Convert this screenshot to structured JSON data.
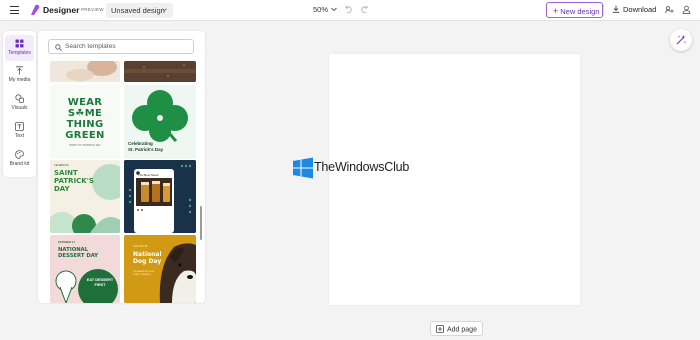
{
  "header": {
    "app_name": "Designer",
    "preview_badge": "PREVIEW",
    "design_name": "Unsaved design",
    "zoom_level": "50%",
    "new_design_label": "New design",
    "download_label": "Download"
  },
  "rail": {
    "items": [
      {
        "label": "Templates",
        "icon": "templates-icon",
        "active": true
      },
      {
        "label": "My media",
        "icon": "upload-icon",
        "active": false
      },
      {
        "label": "Visuals",
        "icon": "shapes-icon",
        "active": false
      },
      {
        "label": "Text",
        "icon": "text-icon",
        "active": false
      },
      {
        "label": "Brand kit",
        "icon": "brand-kit-icon",
        "active": false
      }
    ]
  },
  "templates_panel": {
    "search_placeholder": "Search templates",
    "tiles": [
      {
        "id": "wear-something-green",
        "lines": [
          "WEAR",
          "S☘ME",
          "THING",
          "GREEN"
        ],
        "sub": "HAPPY ST. PATRICK'S DAY"
      },
      {
        "id": "celebrating-st-patricks",
        "text": "Celebrating\nSt. Patrick's Day"
      },
      {
        "id": "saint-patricks-day",
        "small": "CELEBRATE",
        "lines": [
          "SAINT",
          "PATRICK'S",
          "DAY"
        ]
      },
      {
        "id": "the-brew-tavern",
        "title": "The Brew Tavern"
      },
      {
        "id": "national-dessert-day",
        "small": "OCTOBER 14",
        "lines": [
          "NATIONAL",
          "DESSERT DAY"
        ],
        "badge": "EAT DESSERT FIRST"
      },
      {
        "id": "national-dog-day",
        "small": "AUGUST 26",
        "lines": [
          "National",
          "Dog Day"
        ],
        "sub": "CELEBRATING OUR FURRY FRIENDS"
      }
    ]
  },
  "canvas": {
    "watermark_text": "TheWindowsClub"
  },
  "footer": {
    "add_page_label": "Add page"
  },
  "colors": {
    "accent": "#6b2fb6",
    "canvas_bg": "#ffffff",
    "workspace_bg": "#f3f3f3"
  }
}
